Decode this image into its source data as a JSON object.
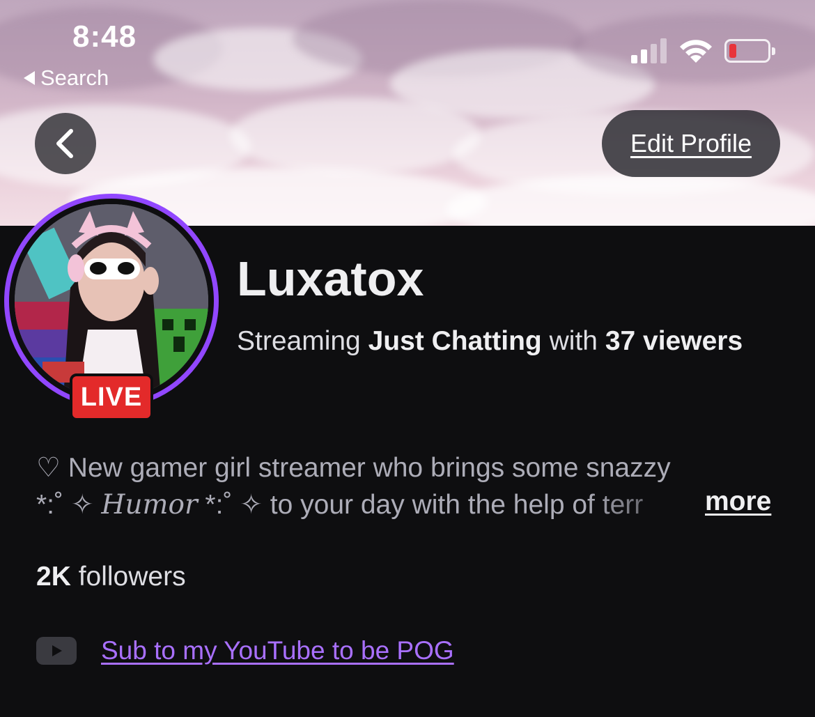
{
  "status_bar": {
    "time": "8:48",
    "back_label": "Search",
    "battery_color": "#e8343b"
  },
  "header": {
    "edit_profile_label": "Edit Profile",
    "back_icon": "chevron-left-icon"
  },
  "profile": {
    "live_label": "LIVE",
    "name": "Luxatox",
    "stream": {
      "prefix": "Streaming",
      "category": "Just Chatting",
      "middle": "with",
      "viewers": "37 viewers"
    },
    "bio": {
      "line1": "♡ New gamer girl streamer who brings some snazzy",
      "line2_a": "*:˚ ✧ ",
      "line2_humor": "Humor",
      "line2_b": " *:˚ ✧ to your day with the help of terr",
      "more_label": "more"
    },
    "followers": {
      "count": "2K",
      "label": "followers"
    },
    "links": [
      {
        "icon": "youtube-icon",
        "label": "Sub to my YouTube to be POG"
      }
    ]
  },
  "colors": {
    "accent": "#9147ff",
    "link": "#a970ff",
    "live": "#e32a2a",
    "background": "#0e0e10"
  }
}
